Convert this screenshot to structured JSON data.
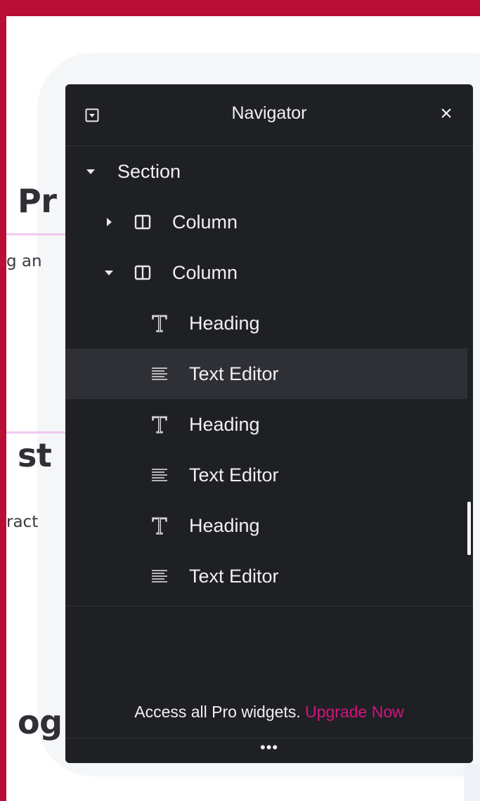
{
  "navigator": {
    "title": "Navigator",
    "close_glyph": "×",
    "tree": [
      {
        "label": "Section",
        "icon": "caret-down-icon",
        "level": 0
      },
      {
        "label": "Column",
        "icon": "column-icon",
        "caret": "caret-right-icon",
        "level": 1
      },
      {
        "label": "Column",
        "icon": "column-icon",
        "caret": "caret-down-icon",
        "level": 1
      },
      {
        "label": "Heading",
        "icon": "heading-icon",
        "level": 2
      },
      {
        "label": "Text Editor",
        "icon": "text-editor-icon",
        "level": 2,
        "active": true
      },
      {
        "label": "Heading",
        "icon": "heading-icon",
        "level": 2
      },
      {
        "label": "Text Editor",
        "icon": "text-editor-icon",
        "level": 2
      },
      {
        "label": "Heading",
        "icon": "heading-icon",
        "level": 2
      },
      {
        "label": "Text Editor",
        "icon": "text-editor-icon",
        "level": 2
      }
    ],
    "promo": {
      "text": "Access all Pro widgets.",
      "link": "Upgrade Now"
    },
    "footer_glyph": "•••"
  },
  "page": {
    "heading_1": "Pr",
    "text_1": "g an",
    "heading_2": "st",
    "text_2": "ract",
    "heading_3": "og"
  },
  "colors": {
    "brand_red": "#b90f35",
    "panel_bg": "#1f2024",
    "active_row": "#2f3035",
    "upgrade_link": "#d1147d",
    "divider_pink": "#f2c9ef"
  }
}
